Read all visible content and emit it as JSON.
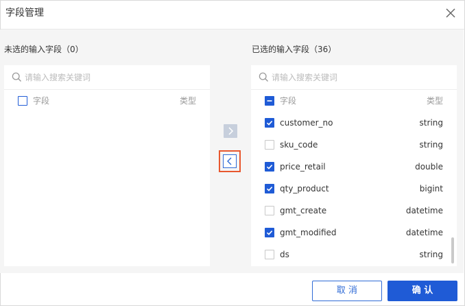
{
  "dialog": {
    "title": "字段管理"
  },
  "left_panel": {
    "title": "未选的输入字段（0）",
    "search_placeholder": "请输入搜索关键词",
    "header_name": "字段",
    "header_type": "类型",
    "header_checked": false
  },
  "right_panel": {
    "title": "已选的输入字段（36）",
    "search_placeholder": "请输入搜索关键词",
    "header_name": "字段",
    "header_type": "类型",
    "header_state": "indeterminate",
    "rows": [
      {
        "name": "customer_no",
        "type": "string",
        "checked": true
      },
      {
        "name": "sku_code",
        "type": "string",
        "checked": false
      },
      {
        "name": "price_retail",
        "type": "double",
        "checked": true
      },
      {
        "name": "qty_product",
        "type": "bigint",
        "checked": true
      },
      {
        "name": "gmt_create",
        "type": "datetime",
        "checked": false
      },
      {
        "name": "gmt_modified",
        "type": "datetime",
        "checked": true
      },
      {
        "name": "ds",
        "type": "string",
        "checked": false
      }
    ]
  },
  "transfer": {
    "move_right_icon": "chevron-right-icon",
    "move_left_icon": "chevron-left-icon"
  },
  "footer": {
    "cancel_label": "取 消",
    "ok_label": "确 认"
  },
  "colors": {
    "primary": "#1f5bd6",
    "highlight": "#e8572e",
    "disabled": "#c7cfdc"
  }
}
